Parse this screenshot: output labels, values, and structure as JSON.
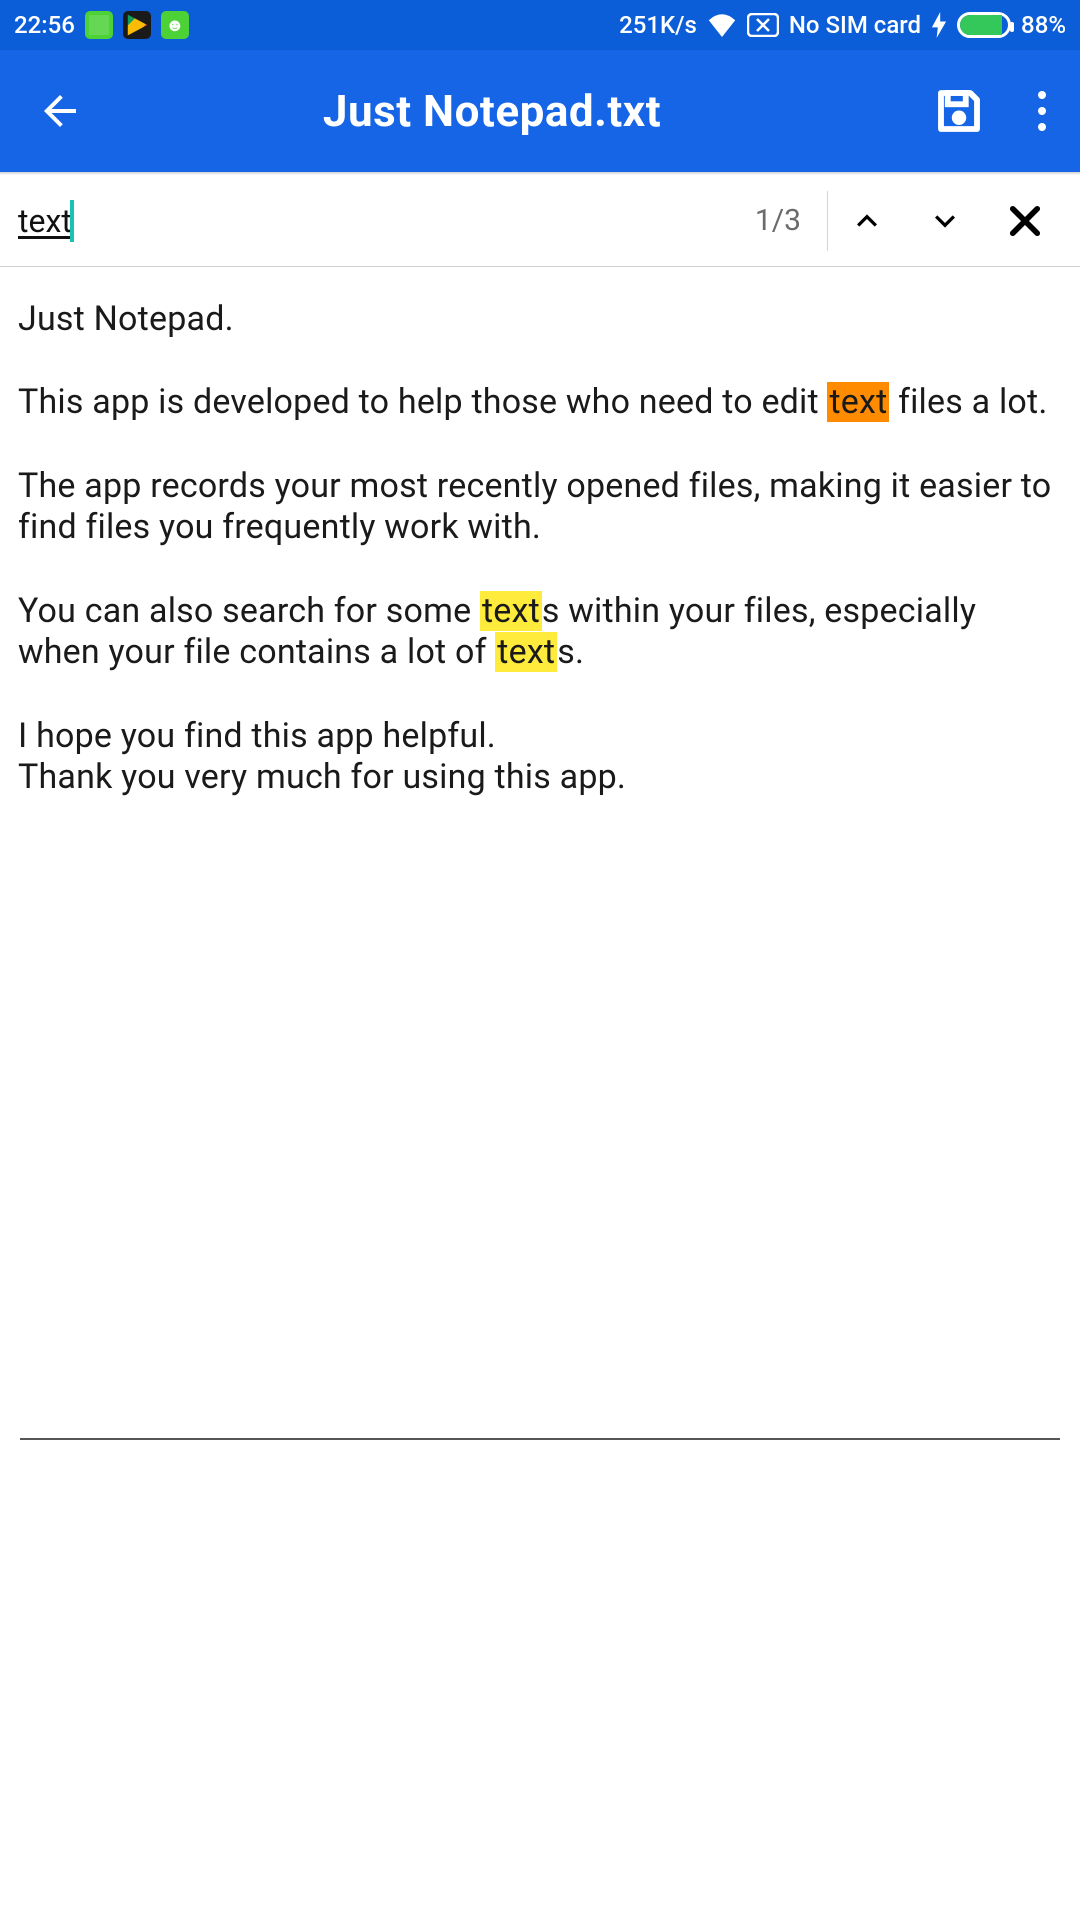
{
  "status": {
    "time": "22:56",
    "net_speed": "251K/s",
    "sim_text": "No SIM card",
    "battery_pct": "88%",
    "battery_fill_pct": 88
  },
  "appbar": {
    "title": "Just Notepad.txt",
    "icons": {
      "back": "back-arrow-icon",
      "save": "save-icon",
      "more": "more-vert-icon"
    }
  },
  "find": {
    "query": "text",
    "position_label": "1/3",
    "icons": {
      "prev": "chevron-up-icon",
      "next": "chevron-down-icon",
      "close": "close-icon"
    }
  },
  "document": {
    "p1": "Just Notepad.",
    "p2a": "This app is developed to help those who need to edit ",
    "p2_hit": "text",
    "p2b": " files a lot.",
    "p3": "The app records your most recently opened files, making it easier to find files you frequently work with.",
    "p4a": "You can also search for some ",
    "p4_hit1": "text",
    "p4b": "s within your files, especially when your file contains a lot of ",
    "p4_hit2": "text",
    "p4c": "s.",
    "p5": "I hope you find this app helpful.",
    "p6": "Thank you very much for using this app."
  },
  "colors": {
    "primary": "#1565e6",
    "highlight_current": "#ff8c00",
    "highlight_other": "#ffeb3b"
  }
}
